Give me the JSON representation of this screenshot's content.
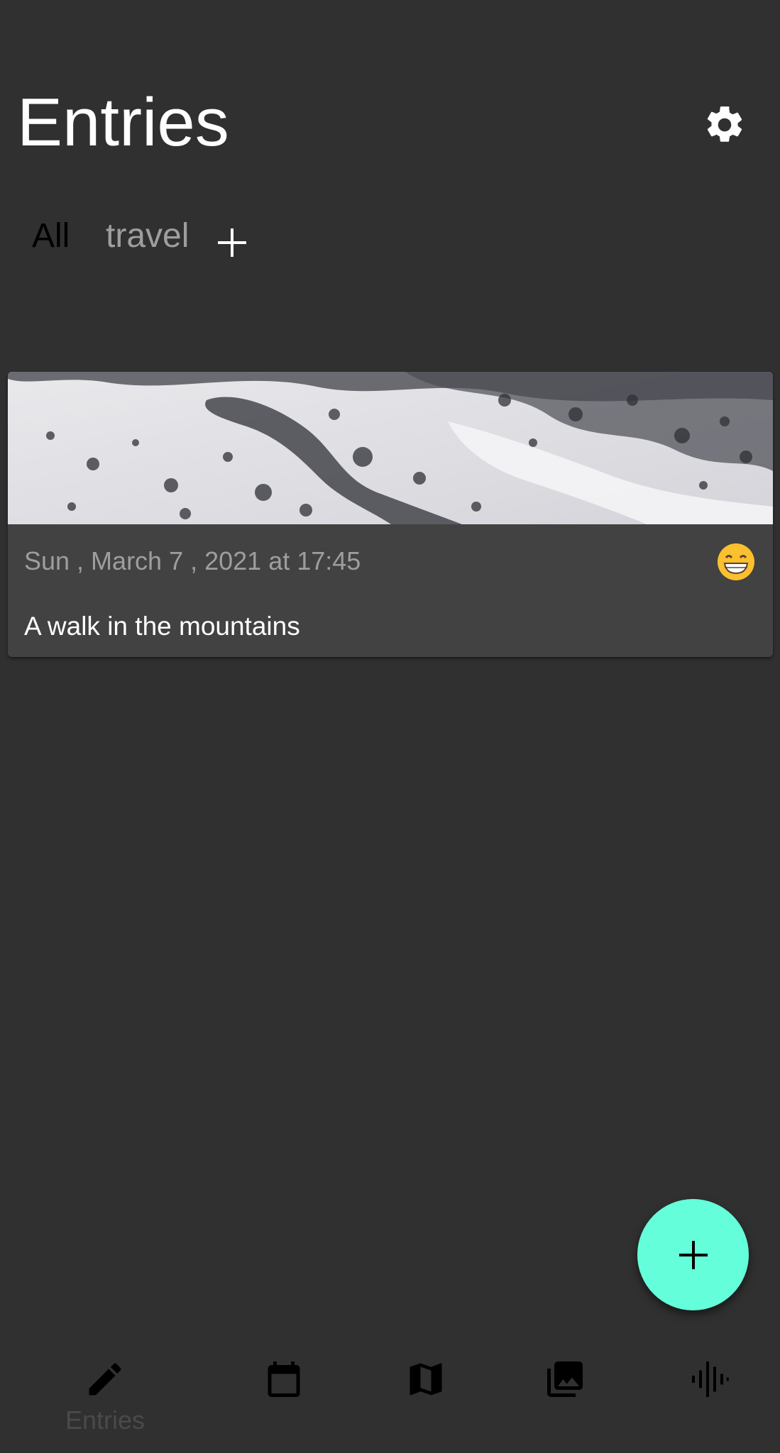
{
  "header": {
    "title": "Entries",
    "settings_icon": "gear-icon"
  },
  "tabs": [
    {
      "label": "All",
      "selected": true
    },
    {
      "label": "travel",
      "selected": false
    }
  ],
  "add_tab_icon": "plus-icon",
  "entries": [
    {
      "date": "Sun , March 7 , 2021 at 17:45",
      "mood": "😁",
      "text": "A walk in the mountains",
      "image": "snowy-mountain-photo"
    }
  ],
  "fab": {
    "icon": "plus-icon",
    "color": "#64ffda"
  },
  "bottom_nav": [
    {
      "label": "Entries",
      "icon": "pencil-icon",
      "active": true
    },
    {
      "label": "",
      "icon": "calendar-icon"
    },
    {
      "label": "",
      "icon": "map-icon"
    },
    {
      "label": "",
      "icon": "photo-library-icon"
    },
    {
      "label": "",
      "icon": "audio-waveform-icon"
    }
  ],
  "colors": {
    "background": "#303030",
    "card": "#424242",
    "accent": "#64ffda"
  }
}
